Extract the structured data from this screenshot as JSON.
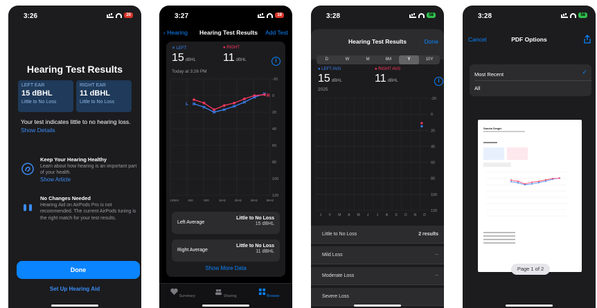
{
  "screen1": {
    "time": "3:26",
    "title": "Hearing Test Results",
    "left_ear": {
      "label": "LEFT EAR",
      "value": "15 dBHL",
      "sub": "Little to No Loss"
    },
    "right_ear": {
      "label": "RIGHT EAR",
      "value": "11 dBHL",
      "sub": "Little to No Loss"
    },
    "summary": "Your test indicates little to no hearing loss.",
    "show_details": "Show Details",
    "item1": {
      "title": "Keep Your Hearing Healthy",
      "body": "Learn about how hearing is an important part of your health.",
      "link": "Show Article",
      "icon": "ear-icon"
    },
    "item2": {
      "title": "No Changes Needed",
      "body": "Hearing Aid on AirPods Pro is not recommended. The current AirPods tuning is the right match for your test results.",
      "icon": "airpods-icon"
    },
    "done": "Done",
    "setup": "Set Up Hearing Aid"
  },
  "screen2": {
    "time": "3:27",
    "back": "Hearing",
    "title": "Hearing Test Results",
    "add": "Add Test",
    "left_tag": "LEFT",
    "right_tag": "RIGHT",
    "left_value": "15",
    "right_value": "11",
    "unit": "dBHL",
    "today": "Today at 3:26 PM",
    "left_avg_label": "Left Average",
    "left_avg_class": "Little to No Loss",
    "left_avg_value": "15 dBHL",
    "right_avg_label": "Right Average",
    "right_avg_class": "Little to No Loss",
    "right_avg_value": "11 dBHL",
    "show_more": "Show More Data",
    "tabs": [
      "Summary",
      "Sharing",
      "Browse"
    ],
    "y_ticks": [
      "-20",
      "0",
      "20",
      "40",
      "60",
      "80",
      "100",
      "120"
    ],
    "x_ticks": [
      "125Hz",
      "250",
      "500",
      "1kHz",
      "2kHz",
      "4kHz",
      "8kHz"
    ],
    "legend_left": "L",
    "legend_right": "R",
    "colors": {
      "left": "#3b82f6",
      "right": "#ff375f"
    }
  },
  "screen3": {
    "time": "3:28",
    "title": "Hearing Test Results",
    "done": "Done",
    "ranges": [
      "D",
      "W",
      "M",
      "6M",
      "Y",
      "10Y"
    ],
    "selected_range": "Y",
    "left_avg_tag": "LEFT AVG",
    "right_avg_tag": "RIGHT AVG",
    "left_avg": "15",
    "right_avg": "11",
    "unit": "dBHL",
    "year": "2025",
    "y_ticks": [
      "-20",
      "0",
      "20",
      "40",
      "60",
      "80",
      "100",
      "120"
    ],
    "months": [
      "J",
      "F",
      "M",
      "A",
      "M",
      "J",
      "J",
      "A",
      "S",
      "O",
      "N",
      "D"
    ],
    "categories": [
      {
        "label": "Little to No Loss",
        "value": "2 results"
      },
      {
        "label": "Mild Loss",
        "value": "--"
      },
      {
        "label": "Moderate Loss",
        "value": "--"
      },
      {
        "label": "Severe Loss",
        "value": ""
      }
    ]
  },
  "screen4": {
    "time": "3:28",
    "cancel": "Cancel",
    "title": "PDF Options",
    "options": [
      "Most Recent",
      "All"
    ],
    "selected": "Most Recent",
    "page_indicator": "Page 1 of 2"
  },
  "chart_data": {
    "type": "line",
    "title": "",
    "xlabel": "",
    "ylabel": "",
    "categories": [
      "125Hz",
      "250",
      "500",
      "1kHz",
      "2kHz",
      "4kHz",
      "8kHz"
    ],
    "ylim": [
      -20,
      120
    ],
    "y_inverted": true,
    "series": [
      {
        "name": "L",
        "values": [
          10,
          14,
          20,
          17,
          13,
          8,
          2,
          -2
        ]
      },
      {
        "name": "R",
        "values": [
          5,
          9,
          17,
          12,
          9,
          4,
          0,
          -1
        ]
      }
    ],
    "grid": true,
    "legend": "inline"
  }
}
